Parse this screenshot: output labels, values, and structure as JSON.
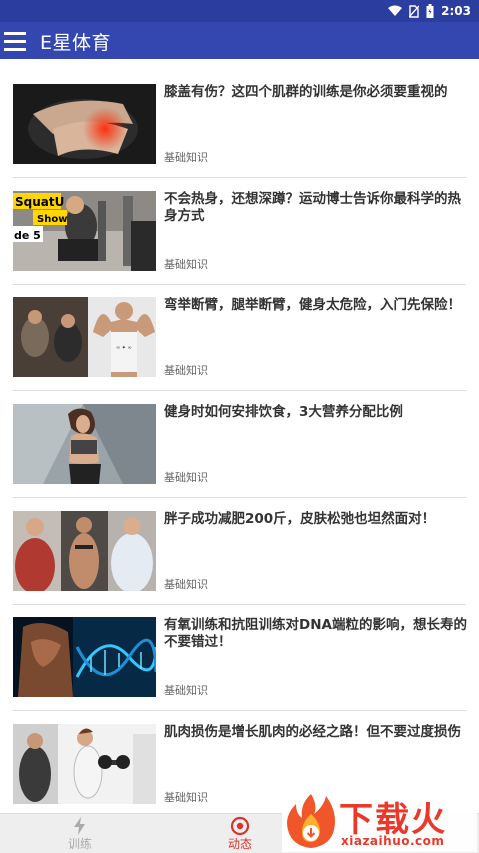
{
  "status_bar": {
    "time": "2:03",
    "icons": [
      "wifi-icon",
      "no-sim-icon",
      "battery-icon"
    ]
  },
  "app_bar": {
    "title": "E星体育",
    "menu_icon": "hamburger-menu-icon",
    "color": "#3446b0"
  },
  "articles": [
    {
      "title": "膝盖有伤？这四个肌群的训练是你必须要重视的",
      "category": "基础知识",
      "thumbnail": "knee-injury-photo"
    },
    {
      "title": "不会热身，还想深蹲？运动博士告诉你最科学的热身方式",
      "category": "基础知识",
      "thumbnail": "squat-show-photo",
      "thumbnail_text": [
        "SquatU",
        "Show",
        "de 5"
      ]
    },
    {
      "title": "弯举断臂，腿举断臂，健身太危险，入门先保险！",
      "category": "基础知识",
      "thumbnail": "bodybuilders-gym-photo"
    },
    {
      "title": "健身时如何安排饮食，3大营养分配比例",
      "category": "基础知识",
      "thumbnail": "fitness-woman-photo"
    },
    {
      "title": "胖子成功减肥200斤，皮肤松弛也坦然面对！",
      "category": "基础知识",
      "thumbnail": "weight-loss-photo"
    },
    {
      "title": "有氧训练和抗阻训练对DNA端粒的影响，想长寿的不要错过！",
      "category": "基础知识",
      "thumbnail": "dna-muscle-photo"
    },
    {
      "title": "肌肉损伤是增长肌肉的必经之路！但不要过度损伤",
      "category": "基础知识",
      "thumbnail": "dumbbell-training-photo"
    }
  ],
  "bottom_nav": {
    "tabs": [
      {
        "label": "训练",
        "icon": "lightning-icon",
        "active": false
      },
      {
        "label": "动态",
        "icon": "target-icon",
        "active": true
      }
    ],
    "active_color": "#d9332b"
  },
  "watermark": {
    "text": "下载火",
    "url": "xiazaihuo.com",
    "icon": "flame-download-icon"
  }
}
